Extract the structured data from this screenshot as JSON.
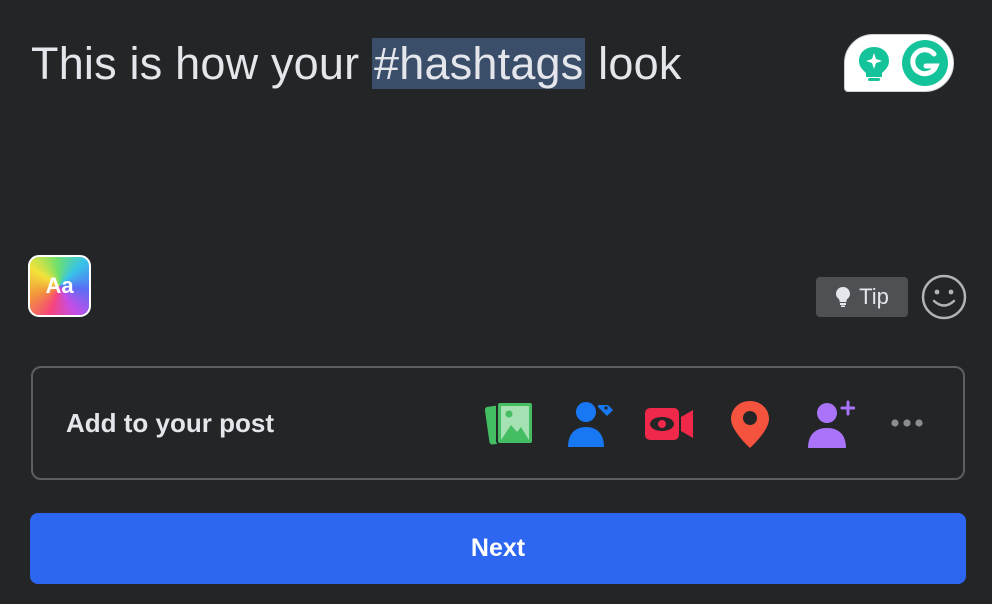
{
  "composer": {
    "text_before": "This is how your ",
    "hashtag": "#hashtags",
    "text_after": " look"
  },
  "format_button": {
    "label": "Aa"
  },
  "tip_button": {
    "label": "Tip"
  },
  "add_to_post": {
    "label": "Add to your post",
    "icons": [
      "photo-video-icon",
      "tag-people-icon",
      "live-video-icon",
      "check-in-icon",
      "invite-collaborator-icon",
      "more-icon"
    ]
  },
  "next_button": {
    "label": "Next"
  },
  "colors": {
    "background": "#242527",
    "accent": "#2d66f0",
    "hashtag_highlight": "#3a4d69",
    "photo_green": "#45bd62",
    "tag_blue": "#1877f2",
    "live_red": "#f02849",
    "checkin_orange": "#f5533d",
    "invite_purple": "#a974f9"
  }
}
